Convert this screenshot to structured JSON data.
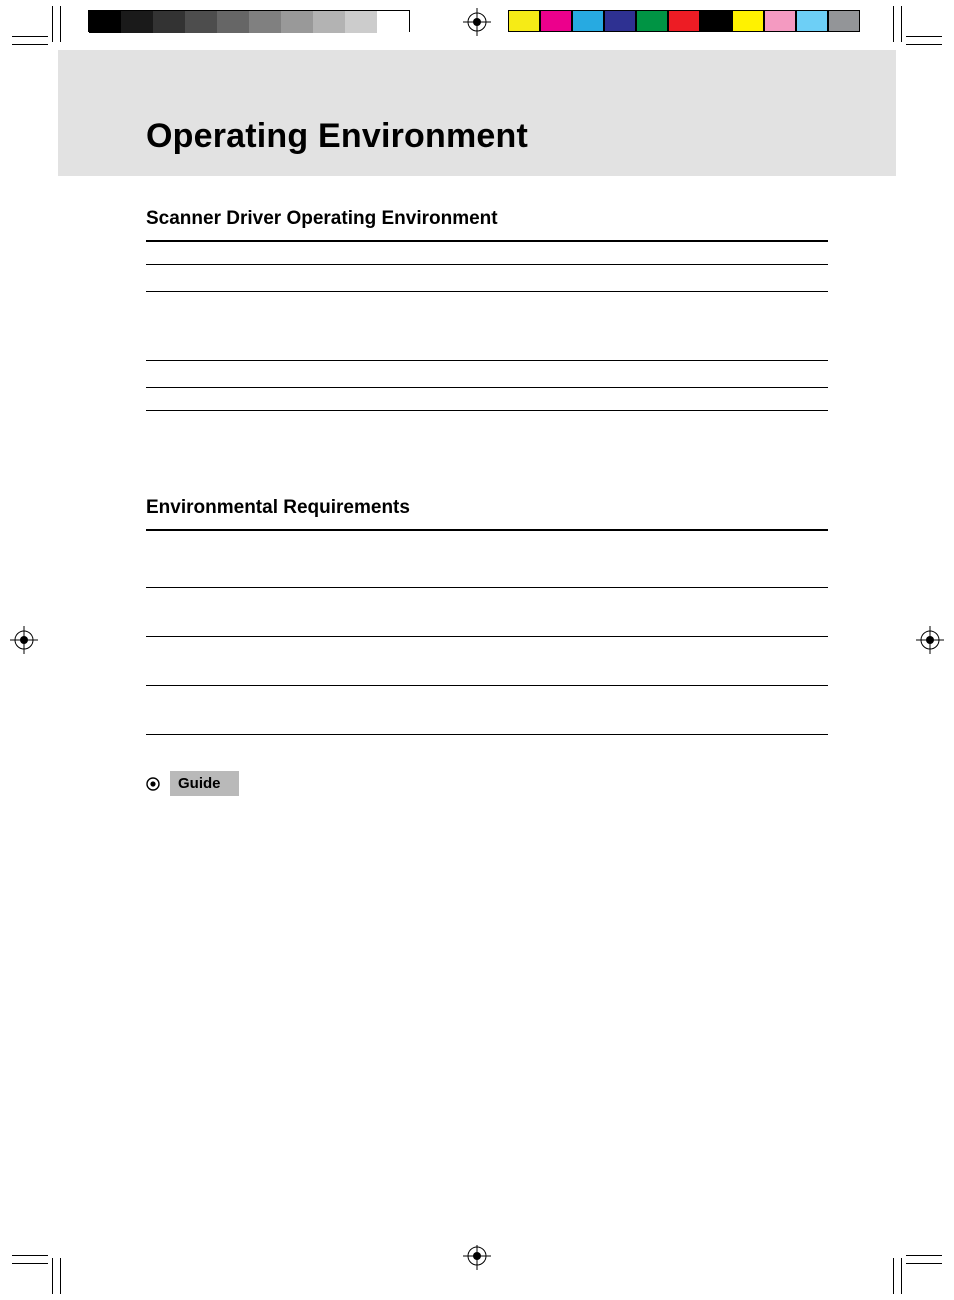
{
  "title": "Operating Environment",
  "sections": [
    {
      "heading": "Scanner Driver Operating Environment"
    },
    {
      "heading": "Environmental Requirements"
    }
  ],
  "guide_label": "Guide",
  "grayscale_swatches": [
    "#000000",
    "#1a1a1a",
    "#333333",
    "#4d4d4d",
    "#666666",
    "#808080",
    "#999999",
    "#b3b3b3",
    "#cccccc",
    "#ffffff"
  ],
  "color_swatches": [
    "#f6eb16",
    "#ec008c",
    "#27aae1",
    "#2e3192",
    "#009444",
    "#ed1c24",
    "#000000",
    "#fff200",
    "#f49ac1",
    "#6dcff6",
    "#939598"
  ]
}
